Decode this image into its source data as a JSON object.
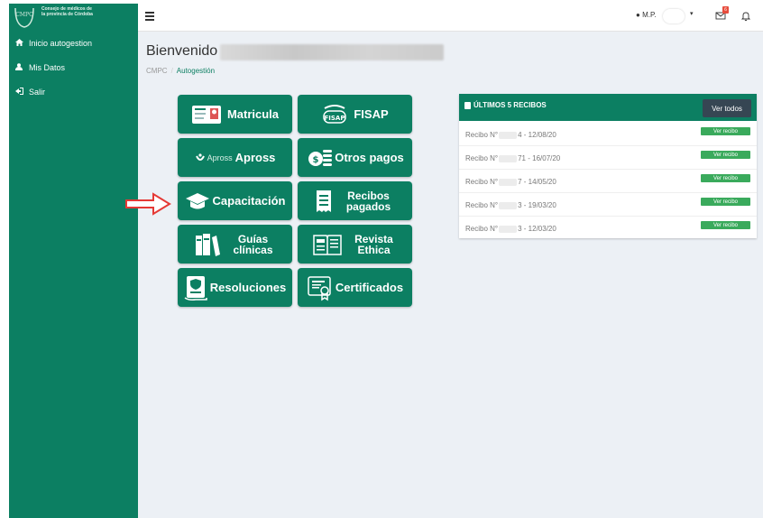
{
  "brand": {
    "logo_text": "Consejo de médicos de la provincia de Córdoba",
    "logo_initials": "CMPC"
  },
  "sidebar": {
    "items": [
      {
        "label": "Inicio autogestion",
        "icon": "home-icon"
      },
      {
        "label": "Mis Datos",
        "icon": "user-icon"
      },
      {
        "label": "Salir",
        "icon": "sign-out-icon"
      }
    ]
  },
  "header": {
    "user_label": "M.P.",
    "mail_badge": "6"
  },
  "page": {
    "title": "Bienvenido",
    "breadcrumb": [
      "CMPC",
      "Autogestión"
    ]
  },
  "tiles": [
    {
      "label": "Matricula",
      "icon": "id-card-icon"
    },
    {
      "label": "FISAP",
      "icon": "fisap-icon"
    },
    {
      "label": "Apross",
      "prefix": "Apross",
      "icon": "apross-icon"
    },
    {
      "label": "Otros pagos",
      "icon": "coins-icon"
    },
    {
      "label": "Capacitación",
      "icon": "graduation-cap-icon"
    },
    {
      "label": "Recibos pagados",
      "icon": "receipt-icon"
    },
    {
      "label": "Guías clínicas",
      "icon": "books-icon"
    },
    {
      "label": "Revista Ethica",
      "icon": "magazine-icon"
    },
    {
      "label": "Resoluciones",
      "icon": "document-shield-icon"
    },
    {
      "label": "Certificados",
      "icon": "certificate-icon"
    }
  ],
  "receipts": {
    "title": "ÚLTIMOS 5 RECIBOS",
    "view_all": "Ver todos",
    "rows": [
      {
        "prefix": "Recibo N°",
        "suffix": "4 - 12/08/20",
        "button": "Ver recibo"
      },
      {
        "prefix": "Recibo N°",
        "suffix": "71 - 16/07/20",
        "button": "Ver recibo"
      },
      {
        "prefix": "Recibo N°",
        "suffix": "7 - 14/05/20",
        "button": "Ver recibo"
      },
      {
        "prefix": "Recibo N°",
        "suffix": "3 - 19/03/20",
        "button": "Ver recibo"
      },
      {
        "prefix": "Recibo N°",
        "suffix": "3 - 12/03/20",
        "button": "Ver recibo"
      }
    ]
  },
  "colors": {
    "primary": "#0c7f62",
    "dark_button": "#364653",
    "success": "#3aaa5c",
    "arrow": "#e53935",
    "background": "#ecf0f5"
  }
}
